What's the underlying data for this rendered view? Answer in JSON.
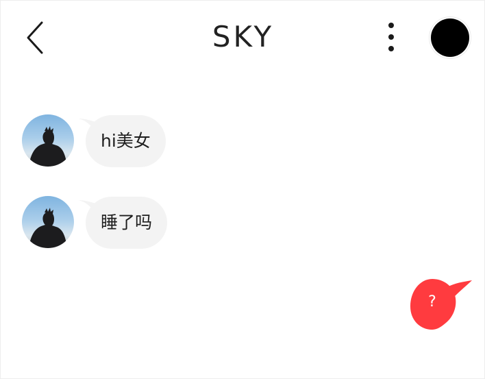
{
  "header": {
    "title": "SKY",
    "back_icon": "chevron-left-icon",
    "more_icon": "more-vertical-icon",
    "profile_color": "#000000"
  },
  "messages": [
    {
      "sender": "other",
      "text": "hi美女"
    },
    {
      "sender": "other",
      "text": "睡了吗"
    }
  ],
  "help_button": {
    "label": "?",
    "color": "#ff3b3f"
  },
  "colors": {
    "bubble_background": "#f3f3f3",
    "background": "#ffffff"
  }
}
